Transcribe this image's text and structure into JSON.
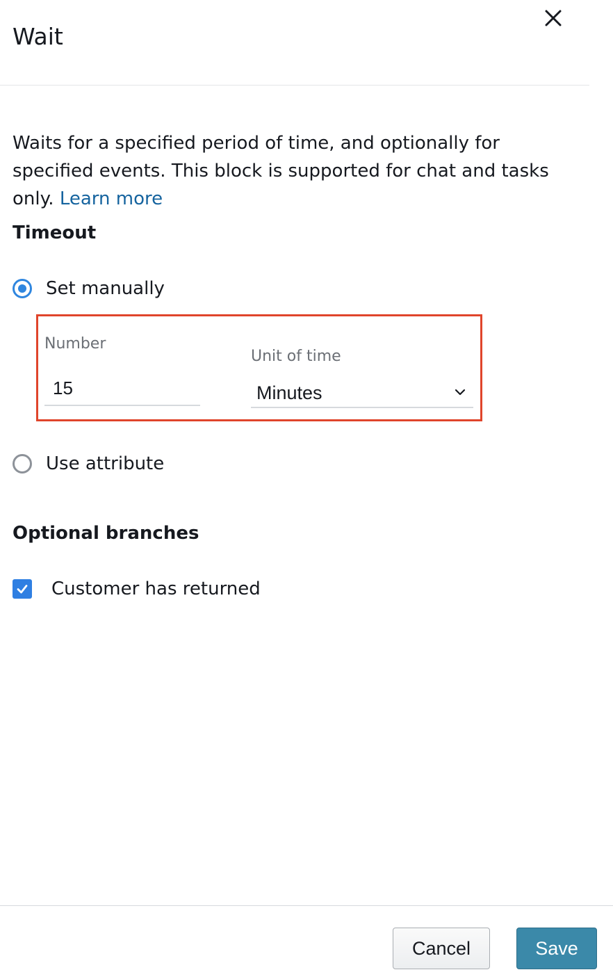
{
  "panel": {
    "title": "Wait",
    "close_icon": "close-icon"
  },
  "description": {
    "text": "Waits for a specified period of time, and optionally for specified events. This block is supported for chat and tasks only.",
    "learn_more": "Learn more"
  },
  "timeout": {
    "heading": "Timeout",
    "options": [
      {
        "label": "Set manually",
        "selected": true
      },
      {
        "label": "Use attribute",
        "selected": false
      }
    ],
    "number_label": "Number",
    "number_value": "15",
    "unit_label": "Unit of time",
    "unit_value": "Minutes"
  },
  "optional_branches": {
    "heading": "Optional branches",
    "items": [
      {
        "label": "Customer has returned",
        "checked": true
      }
    ]
  },
  "footer": {
    "cancel_label": "Cancel",
    "save_label": "Save"
  },
  "colors": {
    "accent": "#2f86df",
    "link": "#16649f",
    "highlight_border": "#e0452b",
    "primary_button": "#3b89a9"
  }
}
